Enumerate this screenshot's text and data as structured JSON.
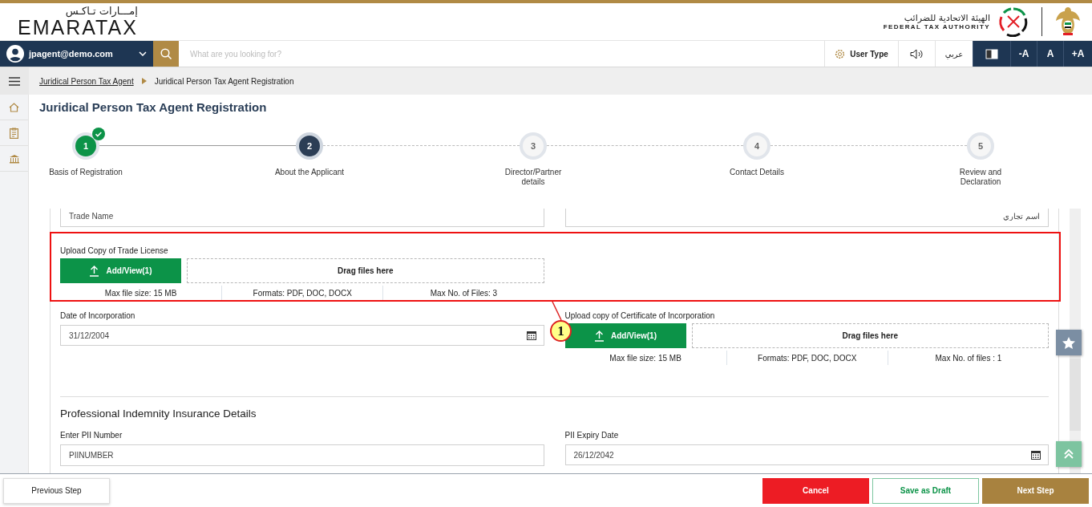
{
  "header": {
    "logo_arabic": "إمـــارات تـاكـس",
    "logo_text": "EMARATAX",
    "authority_arabic": "الهيئة الاتحادية للضرائب",
    "authority_english": "FEDERAL TAX AUTHORITY"
  },
  "toolbar": {
    "user": "jpagent@demo.com",
    "search": {
      "placeholder": "What are you looking for?"
    },
    "user_type": "User Type",
    "language": "عربي",
    "font_buttons": [
      "-A",
      "A",
      "+A"
    ]
  },
  "breadcrumb": [
    "Juridical Person Tax Agent",
    "Juridical Person Tax Agent Registration"
  ],
  "title": "Juridical Person Tax Agent Registration",
  "steps": [
    {
      "number": "1",
      "label": "Basis of Registration",
      "completed": true,
      "selected": false
    },
    {
      "number": "2",
      "label": "About the Applicant",
      "completed": false,
      "selected": true
    },
    {
      "number": "3",
      "label": "Director/Partner details",
      "completed": false,
      "selected": false
    },
    {
      "number": "4",
      "label": "Contact Details",
      "completed": false,
      "selected": false
    },
    {
      "number": "5",
      "label": "Review and Declaration",
      "completed": false,
      "selected": false
    }
  ],
  "trade_name": {
    "english": "Trade Name",
    "arabic": "اسم تجاري"
  },
  "uploads": [
    {
      "label": "Upload Copy of Trade License",
      "button": "Add/View(1)",
      "drop": "Drag files here",
      "info": [
        "Max file size: 15 MB",
        "Formats: PDF, DOC, DOCX",
        "Max No. of Files: 3"
      ]
    },
    {
      "label": "Upload copy of Certificate of Incorporation",
      "button": "Add/View(1)",
      "drop": "Drag files here",
      "info": [
        "Max file size: 15 MB",
        "Formats: PDF, DOC, DOCX",
        "Max No. of files : 1"
      ]
    }
  ],
  "date_of_incorporation": {
    "label": "Date of Incorporation",
    "value": "31/12/2004"
  },
  "pii": {
    "title": "Professional Indemnity Insurance Details",
    "number": {
      "label": "Enter PII Number",
      "value": "PIINUMBER"
    },
    "expiry": {
      "label": "PII Expiry Date",
      "value": "26/12/2042"
    }
  },
  "footer": {
    "previous": "Previous Step",
    "cancel": "Cancel",
    "draft": "Save as Draft",
    "next": "Next Step"
  },
  "annotation": {
    "number": "1"
  }
}
